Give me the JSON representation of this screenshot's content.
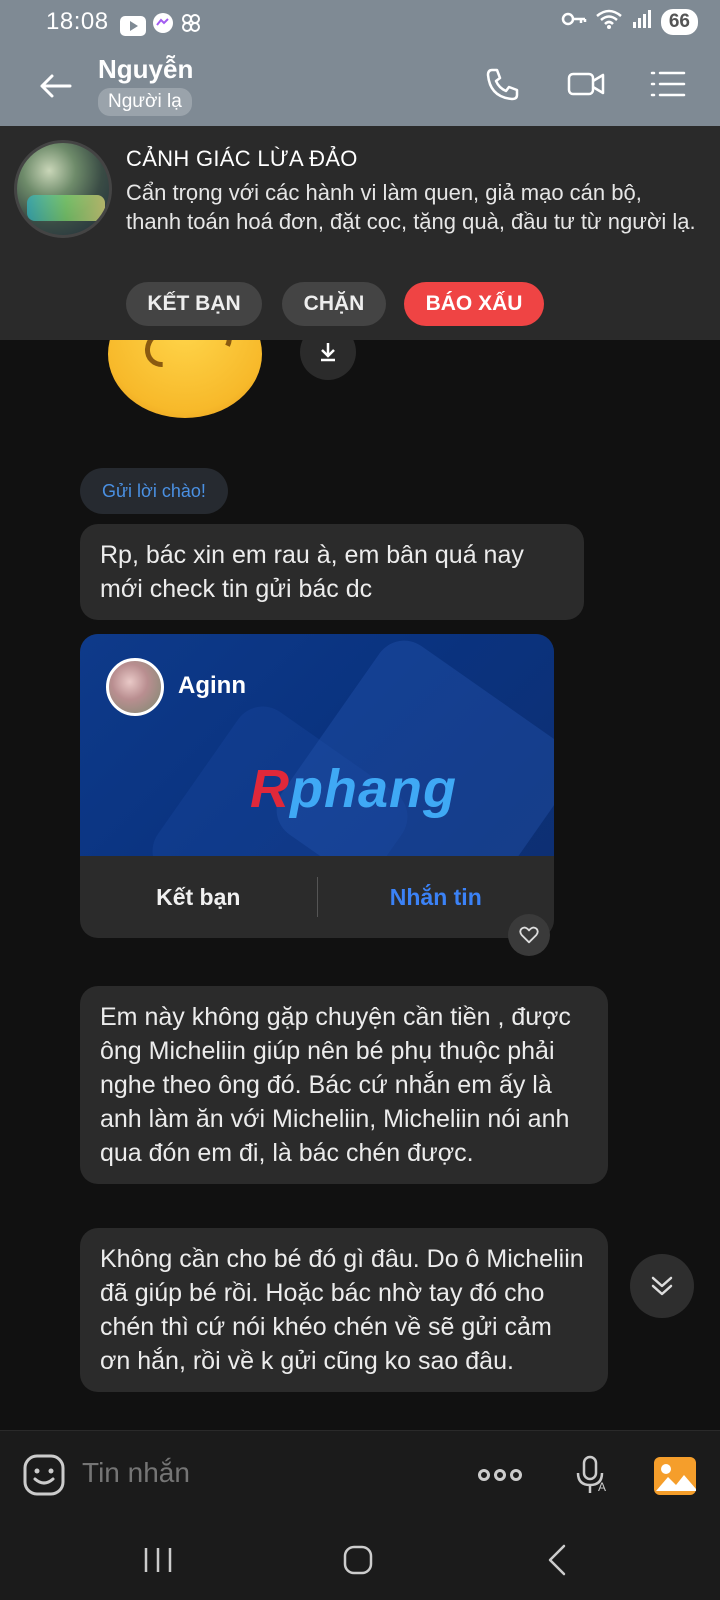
{
  "status_bar": {
    "time": "18:08",
    "battery": "66"
  },
  "header": {
    "contact_name": "Nguyễn",
    "contact_tag": "Người lạ"
  },
  "warning": {
    "title": "CẢNH GIÁC LỪA ĐẢO",
    "text": "Cẩn trọng với các hành vi làm quen, giả mạo cán bộ, thanh toán hoá đơn, đặt cọc, tặng quà, đầu tư từ người lạ.",
    "add_friend_label": "KẾT BẠN",
    "block_label": "CHẶN",
    "report_label": "BÁO XẤU"
  },
  "chat": {
    "greeting_chip": "Gửi lời chào!",
    "messages": [
      "Rp, bác xin em rau à, em bân quá nay mới check tin gửi bác dc",
      "Em này không gặp chuyện cần tiền , được ông Micheliin giúp nên bé phụ thuộc phải nghe theo ông đó. Bác cứ nhắn em ấy là anh làm ăn với Micheliin, Micheliin nói anh qua đón em đi, là bác chén được.",
      "Không cần cho bé đó gì đâu. Do ô Micheliin đã giúp bé rồi. Hoặc bác nhờ tay đó cho chén thì cứ nói khéo chén về sẽ gửi cảm ơn hắn, rồi về k gửi cũng ko sao đâu."
    ],
    "contact_card": {
      "name": "Aginn",
      "logo_first": "R",
      "logo_rest": "phang",
      "add_friend_label": "Kết bạn",
      "message_label": "Nhắn tin"
    }
  },
  "input": {
    "placeholder": "Tin nhắn"
  },
  "colors": {
    "accent_blue": "#3b82f6",
    "report_red": "#ef4444",
    "header_bg": "#7f8a94"
  }
}
